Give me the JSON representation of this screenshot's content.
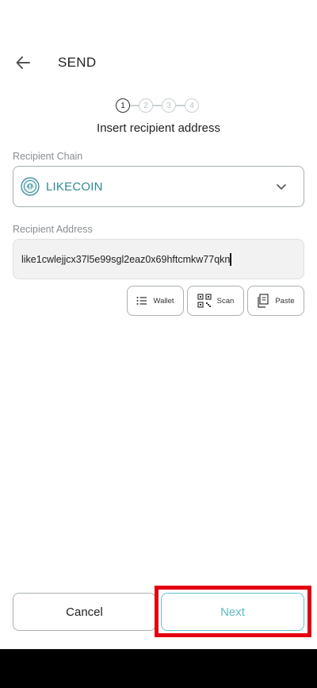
{
  "header": {
    "title": "SEND",
    "back_icon": "arrow-left-icon"
  },
  "stepper": {
    "steps": [
      "1",
      "2",
      "3",
      "4"
    ],
    "active_step": 1
  },
  "subtitle": "Insert recipient address",
  "recipient_chain": {
    "label": "Recipient Chain",
    "value": "LIKECOIN",
    "icon": "likecoin-icon"
  },
  "recipient_address": {
    "label": "Recipient Address",
    "value": "like1cwlejjcx37l5e99sgl2eaz0x69hftcmkw77qkn"
  },
  "actions": {
    "wallet": "Wallet",
    "scan": "Scan",
    "paste": "Paste"
  },
  "footer": {
    "cancel": "Cancel",
    "next": "Next"
  },
  "colors": {
    "accent": "#2f8a94",
    "next_border": "#5fc6cf",
    "highlight": "#e30012"
  }
}
